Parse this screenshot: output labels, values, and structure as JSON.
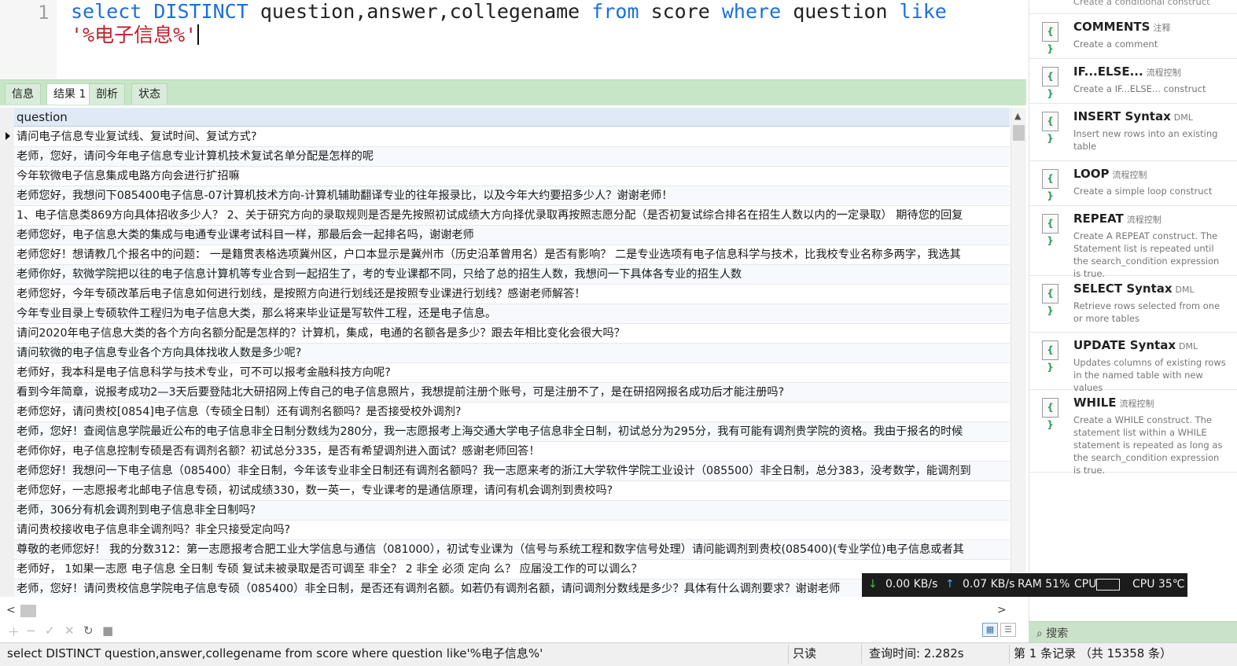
{
  "editor": {
    "line_number": "1",
    "code_tokens": [
      {
        "t": "select",
        "c": "kw"
      },
      {
        "t": " ",
        "c": "id"
      },
      {
        "t": "DISTINCT",
        "c": "kw"
      },
      {
        "t": " question,answer,collegename ",
        "c": "id"
      },
      {
        "t": "from",
        "c": "kw"
      },
      {
        "t": " score ",
        "c": "id"
      },
      {
        "t": "where",
        "c": "kw"
      },
      {
        "t": " question ",
        "c": "id"
      },
      {
        "t": "like",
        "c": "kw"
      },
      {
        "t": "\n",
        "c": "id"
      },
      {
        "t": "'%电子信息%'",
        "c": "str"
      }
    ]
  },
  "tabs": [
    {
      "label": "信息"
    },
    {
      "label": "结果 1",
      "active": true
    },
    {
      "label": "剖析"
    },
    {
      "label": "状态"
    }
  ],
  "grid": {
    "column_header": "question",
    "rows": [
      "请问电子信息专业复试线、复试时间、复试方式?",
      "老师，您好，请问今年电子信息专业计算机技术复试名单分配是怎样的呢",
      "今年软微电子信息集成电路方向会进行扩招嘛",
      "老师您好，我想问下085400电子信息-07计算机技术方向-计算机辅助翻译专业的往年报录比，以及今年大约要招多少人？谢谢老师！",
      "1、电子信息类869方向具体招收多少人？ 2、关于研究方向的录取规则是否是先按照初试成绩大方向择优录取再按照志愿分配（是否初复试综合排名在招生人数以内的一定录取） 期待您的回复",
      "老师您好，电子信息大类的集成与电通专业课考试科目一样，那最后会一起排名吗，谢谢老师",
      "老师您好！想请教几个报名中的问题： 一是籍贯表格选项冀州区，户口本显示是冀州市（历史沿革曾用名）是否有影响？ 二是专业选项有电子信息科学与技术，比我校专业名称多两字，我选其",
      "老师你好，软微学院把以往的电子信息计算机等专业合到一起招生了，考的专业课都不同，只给了总的招生人数，我想问一下具体各专业的招生人数",
      "老师您好，今年专硕改革后电子信息如何进行划线，是按照方向进行划线还是按照专业课进行划线？感谢老师解答！",
      "今年专业目录上专硕软件工程归为电子信息大类，那么将来毕业证是写软件工程，还是电子信息。",
      "请问2020年电子信息大类的各个方向名额分配是怎样的？计算机，集成，电通的名额各是多少？跟去年相比变化会很大吗？",
      "请问软微的电子信息专业各个方向具体找收人数是多少呢?",
      "老师好，我本科是电子信息科学与技术专业，可不可以报考金融科技方向呢?",
      "看到今年简章，说报考成功2—3天后要登陆北大研招网上传自己的电子信息照片，我想提前注册个账号，可是注册不了，是在研招网报名成功后才能注册吗?",
      "老师您好，请问贵校[0854]电子信息（专硕全日制）还有调剂名额吗？是否接受校外调剂?",
      "老师，您好！查阅信息学院最近公布的电子信息非全日制分数线为280分，我一志愿报考上海交通大学电子信息非全日制，初试总分为295分，我有可能有调剂贵学院的资格。我由于报名的时候",
      "老师你好，电子信息控制专硕是否有调剂名额？初试总分335，是否有希望调剂进入面试？感谢老师回答！",
      "老师您好！我想问一下电子信息（085400）非全日制，今年该专业非全日制还有调剂名额吗？我一志愿来考的浙江大学软件学院工业设计（085500）非全日制，总分383，没考数学，能调剂到",
      "老师您好，一志愿报考北邮电子信息专硕，初试成绩330，数一英一，专业课考的是通信原理，请问有机会调剂到贵校吗?",
      "老师，306分有机会调剂到电子信息非全日制吗?",
      "请问贵校接收电子信息非全调剂吗？非全只接受定向吗?",
      "尊敬的老师您好！ 我的分数312：第一志愿报考合肥工业大学信息与通信（081000），初试专业课为（信号与系统工程和数字信号处理）请问能调剂到贵校(085400)(专业学位)电子信息或者其",
      "老师好， 1如果一志愿 电子信息 全日制 专硕 复试未被录取是否可调至 非全？ 2 非全 必须 定向 么？ 应届没工作的可以调么？",
      "老师，您好！请问贵校信息学院电子信息专硕（085400）非全日制，是否还有调剂名额。如若仍有调剂名额，请问调剂分数线是多少？具体有什么调剂要求？谢谢老师"
    ]
  },
  "status": {
    "sql": "select DISTINCT question,answer,collegename from score where question like'%电子信息%'",
    "mode": "只读",
    "query_time": "查询时间: 2.282s",
    "record": "第 1 条记录 （共 15358 条）"
  },
  "snippets": {
    "prev_desc": "Create a conditional construct",
    "items": [
      {
        "title": "COMMENTS",
        "tag": "注释",
        "desc": "Create a comment"
      },
      {
        "title": "IF...ELSE...",
        "tag": "流程控制",
        "desc": "Create a IF...ELSE... construct"
      },
      {
        "title": "INSERT Syntax",
        "tag": "DML",
        "desc": "Insert new rows into an existing table"
      },
      {
        "title": "LOOP",
        "tag": "流程控制",
        "desc": "Create a simple loop construct"
      },
      {
        "title": "REPEAT",
        "tag": "流程控制",
        "desc": "Create A REPEAT construct. The Statement list is repeated until the search_condition expression is true."
      },
      {
        "title": "SELECT Syntax",
        "tag": "DML",
        "desc": "Retrieve rows selected from one or more tables"
      },
      {
        "title": "UPDATE Syntax",
        "tag": "DML",
        "desc": "Updates columns of existing rows in the named table with new values"
      },
      {
        "title": "WHILE",
        "tag": "流程控制",
        "desc": "Create a WHILE construct. The statement list within a WHILE statement is repeated as long as the search_condition expression is true."
      }
    ]
  },
  "search": {
    "label": "搜索"
  },
  "netbar": {
    "down": "0.00 KB/s",
    "up": "0.07 KB/s",
    "ram": "RAM 51%",
    "cpu_label": "CPU",
    "cpu_temp": "CPU 35℃"
  }
}
